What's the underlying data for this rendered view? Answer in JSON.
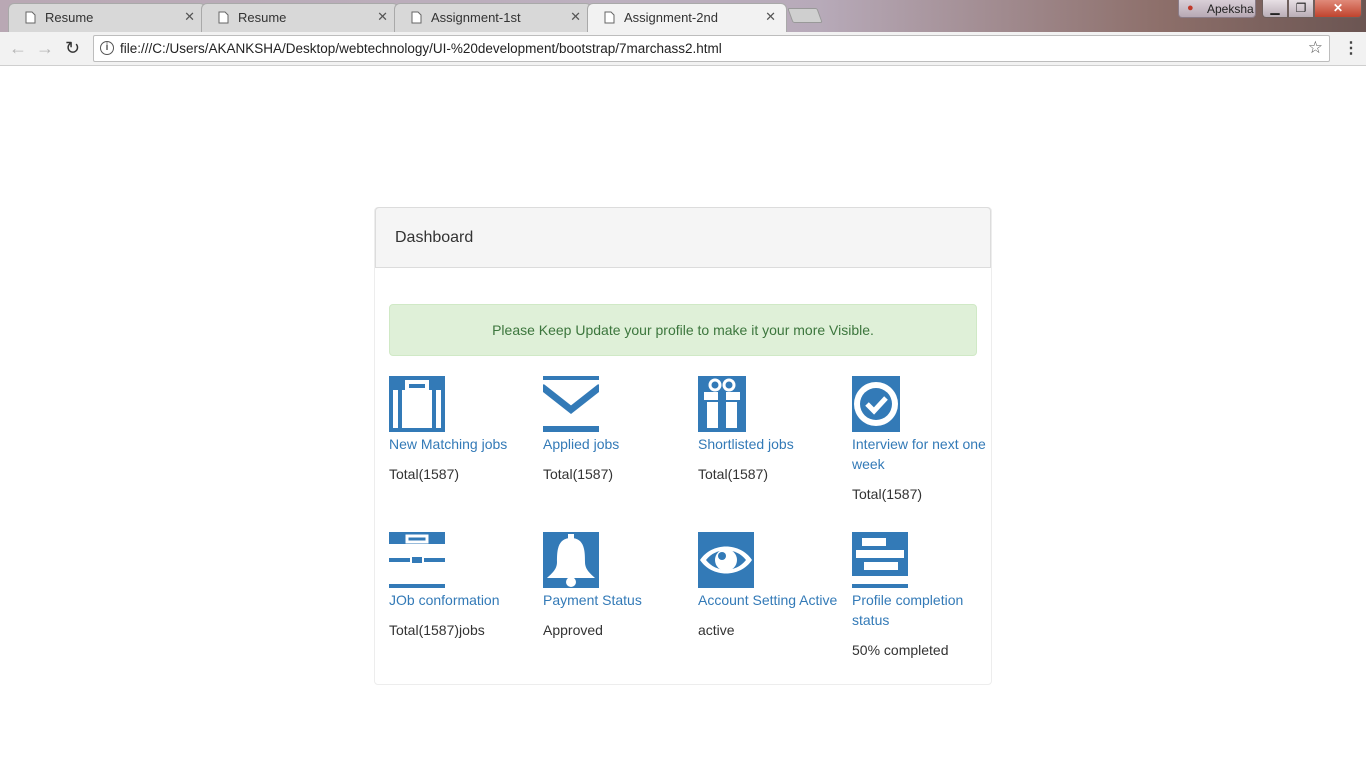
{
  "browser": {
    "tabs": [
      {
        "label": "Resume",
        "active": false
      },
      {
        "label": "Resume",
        "active": false
      },
      {
        "label": "Assignment-1st",
        "active": false
      },
      {
        "label": "Assignment-2nd",
        "active": true
      }
    ],
    "profile_name": "Apeksha",
    "url": "file:///C:/Users/AKANKSHA/Desktop/webtechnology/UI-%20development/bootstrap/7marchass2.html"
  },
  "page": {
    "panel_title": "Dashboard",
    "alert_text": "Please Keep Update your profile to make it your more Visible.",
    "accent_color": "#337ab7",
    "alert_color": "#dff0d8",
    "cards": [
      {
        "icon": "briefcase-icon",
        "label": "New Matching jobs",
        "value": "Total(1587)"
      },
      {
        "icon": "envelope-icon",
        "label": "Applied jobs",
        "value": "Total(1587)"
      },
      {
        "icon": "gift-icon",
        "label": "Shortlisted jobs",
        "value": "Total(1587)"
      },
      {
        "icon": "check-circle-icon",
        "label": "Interview for next one week",
        "value": "Total(1587)"
      },
      {
        "icon": "toolbox-icon",
        "label": "JOb conformation",
        "value": "Total(1587)jobs"
      },
      {
        "icon": "bell-icon",
        "label": "Payment Status",
        "value": "Approved"
      },
      {
        "icon": "eye-icon",
        "label": "Account Setting Active",
        "value": "active"
      },
      {
        "icon": "tasks-icon",
        "label": "Profile completion status",
        "value": "50% completed"
      }
    ]
  }
}
